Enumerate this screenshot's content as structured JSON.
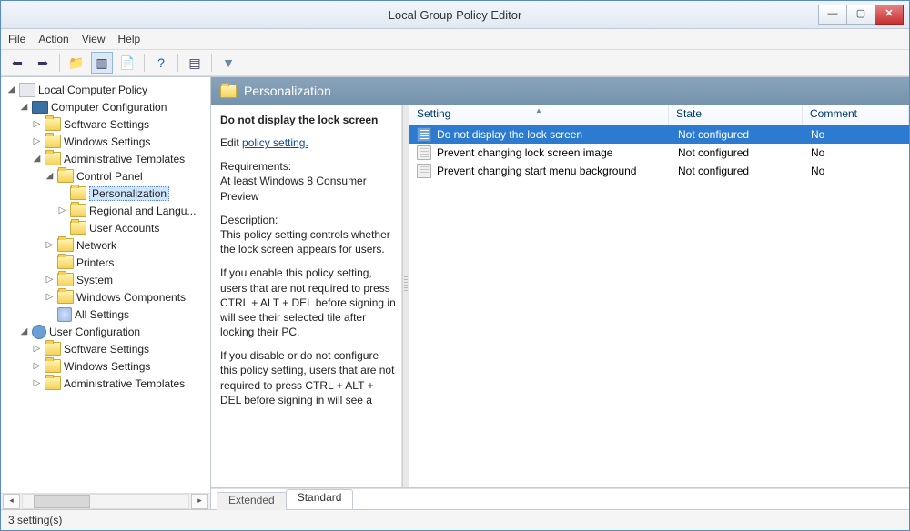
{
  "title": "Local Group Policy Editor",
  "menus": {
    "file": "File",
    "action": "Action",
    "view": "View",
    "help": "Help"
  },
  "tree": {
    "root": "Local Computer Policy",
    "computer_cfg": "Computer Configuration",
    "software_settings": "Software Settings",
    "windows_settings": "Windows Settings",
    "admin_templates": "Administrative Templates",
    "control_panel": "Control Panel",
    "personalization": "Personalization",
    "regional": "Regional and Langu...",
    "user_accounts": "User Accounts",
    "network": "Network",
    "printers": "Printers",
    "system": "System",
    "win_components": "Windows Components",
    "all_settings": "All Settings",
    "user_cfg": "User Configuration",
    "user_software_settings": "Software Settings",
    "user_windows_settings": "Windows Settings",
    "user_admin_templates": "Administrative Templates"
  },
  "header": {
    "title": "Personalization"
  },
  "desc": {
    "selected_title": "Do not display the lock screen",
    "edit_prefix": "Edit ",
    "edit_link": "policy setting.",
    "req_label": "Requirements:",
    "req_text": "At least Windows 8 Consumer Preview",
    "desc_label": "Description:",
    "desc_text1": "This policy setting controls whether the lock screen appears for users.",
    "desc_text2": "If you enable this policy setting, users that are not required to press CTRL + ALT + DEL before signing in will see their selected tile after locking their PC.",
    "desc_text3": "If you disable or do not configure this policy setting, users that are not required to press CTRL + ALT + DEL before signing in will see a"
  },
  "columns": {
    "setting": "Setting",
    "state": "State",
    "comment": "Comment"
  },
  "rows": [
    {
      "name": "Do not display the lock screen",
      "state": "Not configured",
      "comment": "No",
      "selected": true
    },
    {
      "name": "Prevent changing lock screen image",
      "state": "Not configured",
      "comment": "No",
      "selected": false
    },
    {
      "name": "Prevent changing start menu background",
      "state": "Not configured",
      "comment": "No",
      "selected": false
    }
  ],
  "tabs": {
    "extended": "Extended",
    "standard": "Standard"
  },
  "status": "3 setting(s)"
}
